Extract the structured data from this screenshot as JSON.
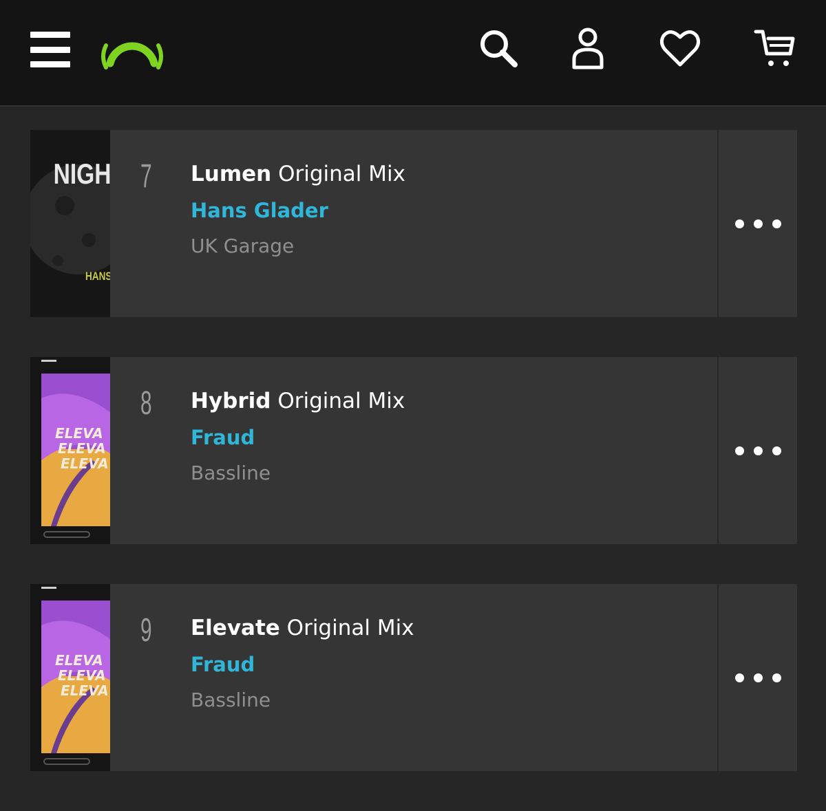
{
  "header": {
    "menu_icon": "hamburger-menu-icon",
    "logo_icon": "beatport-logo-icon",
    "brand_color": "#7fd321",
    "icons": [
      "search-icon",
      "user-icon",
      "heart-icon",
      "cart-icon"
    ]
  },
  "tracks": [
    {
      "rank": "7",
      "title": "Lumen",
      "mix": "Original Mix",
      "artist": "Hans Glader",
      "genre": "UK Garage",
      "art_text": "NIGH",
      "art_sub": "HANS"
    },
    {
      "rank": "8",
      "title": "Hybrid",
      "mix": "Original Mix",
      "artist": "Fraud",
      "genre": "Bassline",
      "art_text": "ELEVA"
    },
    {
      "rank": "9",
      "title": "Elevate",
      "mix": "Original Mix",
      "artist": "Fraud",
      "genre": "Bassline",
      "art_text": "ELEVA"
    }
  ],
  "colors": {
    "header_bg": "#141414",
    "page_bg": "#262626",
    "row_bg": "#353535",
    "artist": "#2fb6d8",
    "genre": "#8f8f8f"
  }
}
